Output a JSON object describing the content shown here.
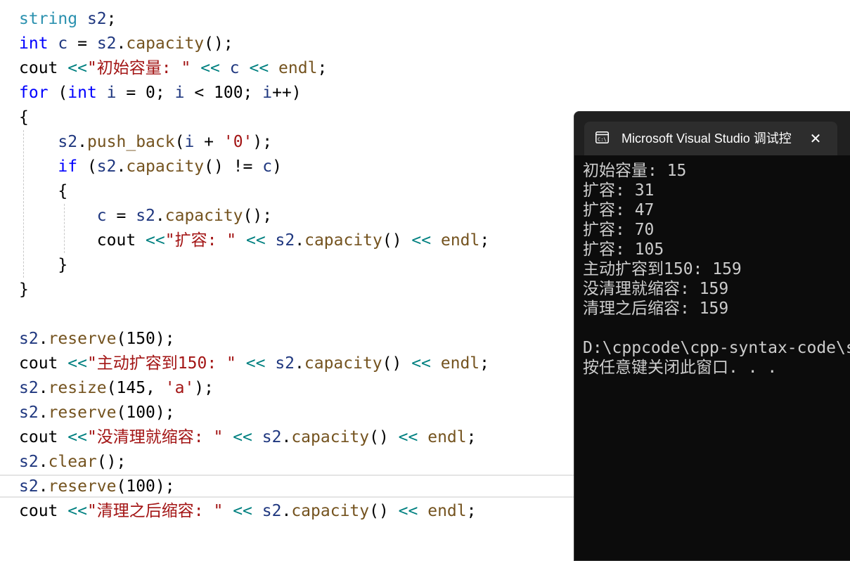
{
  "editor": {
    "lines": [
      [
        {
          "t": "string",
          "c": "type"
        },
        {
          "t": " "
        },
        {
          "t": "s2",
          "c": "var"
        },
        {
          "t": ";"
        }
      ],
      [
        {
          "t": "int",
          "c": "kw"
        },
        {
          "t": " "
        },
        {
          "t": "c",
          "c": "var"
        },
        {
          "t": " = "
        },
        {
          "t": "s2",
          "c": "var"
        },
        {
          "t": "."
        },
        {
          "t": "capacity",
          "c": "fn"
        },
        {
          "t": "();"
        }
      ],
      [
        {
          "t": "cout"
        },
        {
          "t": " "
        },
        {
          "t": "<<",
          "c": "op"
        },
        {
          "t": "\"初始容量: \"",
          "c": "str"
        },
        {
          "t": " "
        },
        {
          "t": "<<",
          "c": "op"
        },
        {
          "t": " "
        },
        {
          "t": "c",
          "c": "var"
        },
        {
          "t": " "
        },
        {
          "t": "<<",
          "c": "op"
        },
        {
          "t": " "
        },
        {
          "t": "endl",
          "c": "fn"
        },
        {
          "t": ";"
        }
      ],
      [
        {
          "t": "for",
          "c": "kw"
        },
        {
          "t": " ("
        },
        {
          "t": "int",
          "c": "kw"
        },
        {
          "t": " "
        },
        {
          "t": "i",
          "c": "var"
        },
        {
          "t": " = 0; "
        },
        {
          "t": "i",
          "c": "var"
        },
        {
          "t": " < 100; "
        },
        {
          "t": "i",
          "c": "var"
        },
        {
          "t": "++)"
        }
      ],
      [
        {
          "t": "{"
        }
      ],
      [
        {
          "t": "    "
        },
        {
          "t": "s2",
          "c": "var"
        },
        {
          "t": "."
        },
        {
          "t": "push_back",
          "c": "fn"
        },
        {
          "t": "("
        },
        {
          "t": "i",
          "c": "var"
        },
        {
          "t": " + "
        },
        {
          "t": "'0'",
          "c": "str"
        },
        {
          "t": ");"
        }
      ],
      [
        {
          "t": "    "
        },
        {
          "t": "if",
          "c": "kw"
        },
        {
          "t": " ("
        },
        {
          "t": "s2",
          "c": "var"
        },
        {
          "t": "."
        },
        {
          "t": "capacity",
          "c": "fn"
        },
        {
          "t": "() != "
        },
        {
          "t": "c",
          "c": "var"
        },
        {
          "t": ")"
        }
      ],
      [
        {
          "t": "    {"
        }
      ],
      [
        {
          "t": "        "
        },
        {
          "t": "c",
          "c": "var"
        },
        {
          "t": " = "
        },
        {
          "t": "s2",
          "c": "var"
        },
        {
          "t": "."
        },
        {
          "t": "capacity",
          "c": "fn"
        },
        {
          "t": "();"
        }
      ],
      [
        {
          "t": "        cout "
        },
        {
          "t": "<<",
          "c": "op"
        },
        {
          "t": "\"扩容: \"",
          "c": "str"
        },
        {
          "t": " "
        },
        {
          "t": "<<",
          "c": "op"
        },
        {
          "t": " "
        },
        {
          "t": "s2",
          "c": "var"
        },
        {
          "t": "."
        },
        {
          "t": "capacity",
          "c": "fn"
        },
        {
          "t": "() "
        },
        {
          "t": "<<",
          "c": "op"
        },
        {
          "t": " "
        },
        {
          "t": "endl",
          "c": "fn"
        },
        {
          "t": ";"
        }
      ],
      [
        {
          "t": "    }"
        }
      ],
      [
        {
          "t": "}"
        }
      ],
      [],
      [
        {
          "t": "s2",
          "c": "var"
        },
        {
          "t": "."
        },
        {
          "t": "reserve",
          "c": "fn"
        },
        {
          "t": "(150);"
        }
      ],
      [
        {
          "t": "cout "
        },
        {
          "t": "<<",
          "c": "op"
        },
        {
          "t": "\"主动扩容到150: \"",
          "c": "str"
        },
        {
          "t": " "
        },
        {
          "t": "<<",
          "c": "op"
        },
        {
          "t": " "
        },
        {
          "t": "s2",
          "c": "var"
        },
        {
          "t": "."
        },
        {
          "t": "capacity",
          "c": "fn"
        },
        {
          "t": "() "
        },
        {
          "t": "<<",
          "c": "op"
        },
        {
          "t": " "
        },
        {
          "t": "endl",
          "c": "fn"
        },
        {
          "t": ";"
        }
      ],
      [
        {
          "t": "s2",
          "c": "var"
        },
        {
          "t": "."
        },
        {
          "t": "resize",
          "c": "fn"
        },
        {
          "t": "(145, "
        },
        {
          "t": "'a'",
          "c": "str"
        },
        {
          "t": ");"
        }
      ],
      [
        {
          "t": "s2",
          "c": "var"
        },
        {
          "t": "."
        },
        {
          "t": "reserve",
          "c": "fn"
        },
        {
          "t": "(100);"
        }
      ],
      [
        {
          "t": "cout "
        },
        {
          "t": "<<",
          "c": "op"
        },
        {
          "t": "\"没清理就缩容: \"",
          "c": "str"
        },
        {
          "t": " "
        },
        {
          "t": "<<",
          "c": "op"
        },
        {
          "t": " "
        },
        {
          "t": "s2",
          "c": "var"
        },
        {
          "t": "."
        },
        {
          "t": "capacity",
          "c": "fn"
        },
        {
          "t": "() "
        },
        {
          "t": "<<",
          "c": "op"
        },
        {
          "t": " "
        },
        {
          "t": "endl",
          "c": "fn"
        },
        {
          "t": ";"
        }
      ],
      [
        {
          "t": "s2",
          "c": "var"
        },
        {
          "t": "."
        },
        {
          "t": "clear",
          "c": "fn"
        },
        {
          "t": "();"
        }
      ],
      [
        {
          "t": "s2",
          "c": "var"
        },
        {
          "t": "."
        },
        {
          "t": "reserve",
          "c": "fn"
        },
        {
          "t": "(100);"
        }
      ],
      [
        {
          "t": "cout "
        },
        {
          "t": "<<",
          "c": "op"
        },
        {
          "t": "\"清理之后缩容: \"",
          "c": "str"
        },
        {
          "t": " "
        },
        {
          "t": "<<",
          "c": "op"
        },
        {
          "t": " "
        },
        {
          "t": "s2",
          "c": "var"
        },
        {
          "t": "."
        },
        {
          "t": "capacity",
          "c": "fn"
        },
        {
          "t": "() "
        },
        {
          "t": "<<",
          "c": "op"
        },
        {
          "t": " "
        },
        {
          "t": "endl",
          "c": "fn"
        },
        {
          "t": ";"
        }
      ]
    ],
    "colors": {
      "kw": "#0000ff",
      "type": "#2b91af",
      "var": "#1f377f",
      "fn": "#74531f",
      "str": "#a31515",
      "op": "#008080"
    }
  },
  "console": {
    "tab_title": "Microsoft Visual Studio 调试控",
    "tab_icon": "console-app-icon",
    "close_icon": "close-icon",
    "output": [
      "初始容量: 15",
      "扩容: 31",
      "扩容: 47",
      "扩容: 70",
      "扩容: 105",
      "主动扩容到150: 159",
      "没清理就缩容: 159",
      "清理之后缩容: 159",
      "",
      "D:\\cppcode\\cpp-syntax-code\\s",
      "按任意键关闭此窗口. . ."
    ],
    "background": "#0c0c0c",
    "text_color": "#cccccc"
  }
}
